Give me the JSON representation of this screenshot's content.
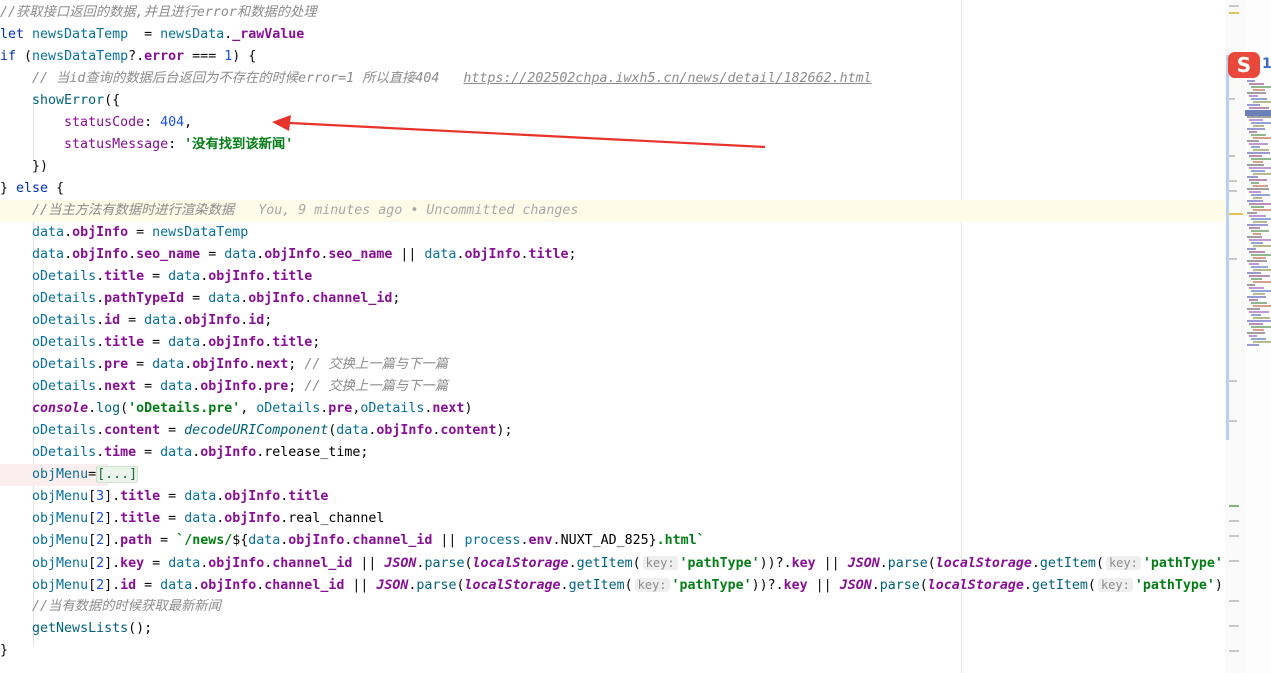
{
  "lines": [
    [
      {
        "t": "//获取接口返回的数据,并且进行error和数据的处理",
        "c": "c"
      }
    ],
    [
      {
        "t": "let ",
        "c": "kw"
      },
      {
        "t": "newsDataTemp  ",
        "c": "lv"
      },
      {
        "t": "= ",
        "c": "plain"
      },
      {
        "t": "newsData",
        "c": "lv"
      },
      {
        "t": ".",
        "c": "plain"
      },
      {
        "t": "_rawValue",
        "c": "prop"
      }
    ],
    [
      {
        "t": "if ",
        "c": "kw"
      },
      {
        "t": "(",
        "c": "plain"
      },
      {
        "t": "newsDataTemp",
        "c": "lv"
      },
      {
        "t": "?.",
        "c": "plain"
      },
      {
        "t": "error",
        "c": "prop"
      },
      {
        "t": " === ",
        "c": "plain"
      },
      {
        "t": "1",
        "c": "num"
      },
      {
        "t": ") {",
        "c": "plain"
      }
    ],
    [
      {
        "t": "    // 当id查询的数据后台返回为不存在的时候error=1 所以直接404   ",
        "c": "c"
      },
      {
        "t": "https://202502chpa.iwxh5.cn/news/detail/182662.html",
        "c": "url"
      }
    ],
    [
      {
        "t": "    ",
        "c": "plain"
      },
      {
        "t": "showError",
        "c": "fn"
      },
      {
        "t": "({",
        "c": "plain"
      }
    ],
    [
      {
        "t": "        ",
        "c": "plain"
      },
      {
        "t": "statusCode",
        "c": "propn"
      },
      {
        "t": ": ",
        "c": "plain"
      },
      {
        "t": "404",
        "c": "num"
      },
      {
        "t": ",",
        "c": "plain"
      }
    ],
    [
      {
        "t": "        ",
        "c": "plain"
      },
      {
        "t": "statusMessage",
        "c": "propn"
      },
      {
        "t": ": ",
        "c": "plain"
      },
      {
        "t": "'没有找到该新闻'",
        "c": "str"
      }
    ],
    [
      {
        "t": "    })",
        "c": "plain"
      }
    ],
    [
      {
        "t": "} ",
        "c": "plain"
      },
      {
        "t": "else ",
        "c": "kw"
      },
      {
        "t": "{",
        "c": "plain"
      }
    ],
    [
      {
        "t": "    //当主方法有数据时进行渲染数据   ",
        "c": "c"
      },
      {
        "t": "You, 9 minutes ago • Uncommitted changes",
        "c": "blame"
      }
    ],
    [
      {
        "t": "    ",
        "c": "plain"
      },
      {
        "t": "data",
        "c": "lv"
      },
      {
        "t": ".",
        "c": "plain"
      },
      {
        "t": "objInfo",
        "c": "prop"
      },
      {
        "t": " = ",
        "c": "plain"
      },
      {
        "t": "newsDataTemp",
        "c": "lv"
      }
    ],
    [
      {
        "t": "    ",
        "c": "plain"
      },
      {
        "t": "data",
        "c": "lv"
      },
      {
        "t": ".",
        "c": "plain"
      },
      {
        "t": "objInfo",
        "c": "prop"
      },
      {
        "t": ".",
        "c": "plain"
      },
      {
        "t": "seo_name",
        "c": "prop"
      },
      {
        "t": " = ",
        "c": "plain"
      },
      {
        "t": "data",
        "c": "lv"
      },
      {
        "t": ".",
        "c": "plain"
      },
      {
        "t": "objInfo",
        "c": "prop"
      },
      {
        "t": ".",
        "c": "plain"
      },
      {
        "t": "seo_name",
        "c": "prop"
      },
      {
        "t": " || ",
        "c": "plain"
      },
      {
        "t": "data",
        "c": "lv"
      },
      {
        "t": ".",
        "c": "plain"
      },
      {
        "t": "objInfo",
        "c": "prop"
      },
      {
        "t": ".",
        "c": "plain"
      },
      {
        "t": "title",
        "c": "prop"
      },
      {
        "t": ";",
        "c": "plain"
      }
    ],
    [
      {
        "t": "    ",
        "c": "plain"
      },
      {
        "t": "oDetails",
        "c": "lv"
      },
      {
        "t": ".",
        "c": "plain"
      },
      {
        "t": "title",
        "c": "prop"
      },
      {
        "t": " = ",
        "c": "plain"
      },
      {
        "t": "data",
        "c": "lv"
      },
      {
        "t": ".",
        "c": "plain"
      },
      {
        "t": "objInfo",
        "c": "prop"
      },
      {
        "t": ".",
        "c": "plain"
      },
      {
        "t": "title",
        "c": "prop"
      }
    ],
    [
      {
        "t": "    ",
        "c": "plain"
      },
      {
        "t": "oDetails",
        "c": "lv"
      },
      {
        "t": ".",
        "c": "plain"
      },
      {
        "t": "pathTypeId",
        "c": "prop"
      },
      {
        "t": " = ",
        "c": "plain"
      },
      {
        "t": "data",
        "c": "lv"
      },
      {
        "t": ".",
        "c": "plain"
      },
      {
        "t": "objInfo",
        "c": "prop"
      },
      {
        "t": ".",
        "c": "plain"
      },
      {
        "t": "channel_id",
        "c": "prop"
      },
      {
        "t": ";",
        "c": "plain"
      }
    ],
    [
      {
        "t": "    ",
        "c": "plain"
      },
      {
        "t": "oDetails",
        "c": "lv"
      },
      {
        "t": ".",
        "c": "plain"
      },
      {
        "t": "id",
        "c": "prop"
      },
      {
        "t": " = ",
        "c": "plain"
      },
      {
        "t": "data",
        "c": "lv"
      },
      {
        "t": ".",
        "c": "plain"
      },
      {
        "t": "objInfo",
        "c": "prop"
      },
      {
        "t": ".",
        "c": "plain"
      },
      {
        "t": "id",
        "c": "prop"
      },
      {
        "t": ";",
        "c": "plain"
      }
    ],
    [
      {
        "t": "    ",
        "c": "plain"
      },
      {
        "t": "oDetails",
        "c": "lv"
      },
      {
        "t": ".",
        "c": "plain"
      },
      {
        "t": "title",
        "c": "prop"
      },
      {
        "t": " = ",
        "c": "plain"
      },
      {
        "t": "data",
        "c": "lv"
      },
      {
        "t": ".",
        "c": "plain"
      },
      {
        "t": "objInfo",
        "c": "prop"
      },
      {
        "t": ".",
        "c": "plain"
      },
      {
        "t": "title",
        "c": "prop"
      },
      {
        "t": ";",
        "c": "plain"
      }
    ],
    [
      {
        "t": "    ",
        "c": "plain"
      },
      {
        "t": "oDetails",
        "c": "lv"
      },
      {
        "t": ".",
        "c": "plain"
      },
      {
        "t": "pre",
        "c": "prop"
      },
      {
        "t": " = ",
        "c": "plain"
      },
      {
        "t": "data",
        "c": "lv"
      },
      {
        "t": ".",
        "c": "plain"
      },
      {
        "t": "objInfo",
        "c": "prop"
      },
      {
        "t": ".",
        "c": "plain"
      },
      {
        "t": "next",
        "c": "prop"
      },
      {
        "t": "; ",
        "c": "plain"
      },
      {
        "t": "// 交换上一篇与下一篇",
        "c": "c"
      }
    ],
    [
      {
        "t": "    ",
        "c": "plain"
      },
      {
        "t": "oDetails",
        "c": "lv"
      },
      {
        "t": ".",
        "c": "plain"
      },
      {
        "t": "next",
        "c": "prop"
      },
      {
        "t": " = ",
        "c": "plain"
      },
      {
        "t": "data",
        "c": "lv"
      },
      {
        "t": ".",
        "c": "plain"
      },
      {
        "t": "objInfo",
        "c": "prop"
      },
      {
        "t": ".",
        "c": "plain"
      },
      {
        "t": "pre",
        "c": "prop"
      },
      {
        "t": "; ",
        "c": "plain"
      },
      {
        "t": "// 交换上一篇与下一篇",
        "c": "c"
      }
    ],
    [
      {
        "t": "    ",
        "c": "plain"
      },
      {
        "t": "console",
        "c": "gbl"
      },
      {
        "t": ".",
        "c": "plain"
      },
      {
        "t": "log",
        "c": "fn"
      },
      {
        "t": "(",
        "c": "plain"
      },
      {
        "t": "'oDetails.pre'",
        "c": "str"
      },
      {
        "t": ", ",
        "c": "plain"
      },
      {
        "t": "oDetails",
        "c": "lv"
      },
      {
        "t": ".",
        "c": "plain"
      },
      {
        "t": "pre",
        "c": "prop"
      },
      {
        "t": ",",
        "c": "plain"
      },
      {
        "t": "oDetails",
        "c": "lv"
      },
      {
        "t": ".",
        "c": "plain"
      },
      {
        "t": "next",
        "c": "prop"
      },
      {
        "t": ")",
        "c": "plain"
      }
    ],
    [
      {
        "t": "    ",
        "c": "plain"
      },
      {
        "t": "oDetails",
        "c": "lv"
      },
      {
        "t": ".",
        "c": "plain"
      },
      {
        "t": "content",
        "c": "prop"
      },
      {
        "t": " = ",
        "c": "plain"
      },
      {
        "t": "decodeURIComponent",
        "c": "fni"
      },
      {
        "t": "(",
        "c": "plain"
      },
      {
        "t": "data",
        "c": "lv"
      },
      {
        "t": ".",
        "c": "plain"
      },
      {
        "t": "objInfo",
        "c": "prop"
      },
      {
        "t": ".",
        "c": "plain"
      },
      {
        "t": "content",
        "c": "prop"
      },
      {
        "t": ");",
        "c": "plain"
      }
    ],
    [
      {
        "t": "    ",
        "c": "plain"
      },
      {
        "t": "oDetails",
        "c": "lv"
      },
      {
        "t": ".",
        "c": "plain"
      },
      {
        "t": "time",
        "c": "prop"
      },
      {
        "t": " = ",
        "c": "plain"
      },
      {
        "t": "data",
        "c": "lv"
      },
      {
        "t": ".",
        "c": "plain"
      },
      {
        "t": "objInfo",
        "c": "prop"
      },
      {
        "t": ".",
        "c": "plain"
      },
      {
        "t": "release_time",
        "c": "v"
      },
      {
        "t": ";",
        "c": "plain"
      }
    ],
    [
      {
        "t": "    ",
        "c": "plain"
      },
      {
        "t": "objMenu",
        "c": "lv"
      },
      {
        "t": "=",
        "c": "plain"
      },
      {
        "t": "[...]",
        "c": "fold"
      }
    ],
    [
      {
        "t": "    ",
        "c": "plain"
      },
      {
        "t": "objMenu",
        "c": "lv"
      },
      {
        "t": "[",
        "c": "plain"
      },
      {
        "t": "3",
        "c": "num"
      },
      {
        "t": "].",
        "c": "plain"
      },
      {
        "t": "title",
        "c": "prop"
      },
      {
        "t": " = ",
        "c": "plain"
      },
      {
        "t": "data",
        "c": "lv"
      },
      {
        "t": ".",
        "c": "plain"
      },
      {
        "t": "objInfo",
        "c": "prop"
      },
      {
        "t": ".",
        "c": "plain"
      },
      {
        "t": "title",
        "c": "prop"
      }
    ],
    [
      {
        "t": "    ",
        "c": "plain"
      },
      {
        "t": "objMenu",
        "c": "lv"
      },
      {
        "t": "[",
        "c": "plain"
      },
      {
        "t": "2",
        "c": "num"
      },
      {
        "t": "].",
        "c": "plain"
      },
      {
        "t": "title",
        "c": "prop"
      },
      {
        "t": " = ",
        "c": "plain"
      },
      {
        "t": "data",
        "c": "lv"
      },
      {
        "t": ".",
        "c": "plain"
      },
      {
        "t": "objInfo",
        "c": "prop"
      },
      {
        "t": ".",
        "c": "plain"
      },
      {
        "t": "real_channel",
        "c": "v"
      }
    ],
    [
      {
        "t": "    ",
        "c": "plain"
      },
      {
        "t": "objMenu",
        "c": "lv"
      },
      {
        "t": "[",
        "c": "plain"
      },
      {
        "t": "2",
        "c": "num"
      },
      {
        "t": "].",
        "c": "plain"
      },
      {
        "t": "path",
        "c": "prop"
      },
      {
        "t": " = ",
        "c": "plain"
      },
      {
        "t": "`/news/",
        "c": "str"
      },
      {
        "t": "${",
        "c": "plain"
      },
      {
        "t": "data",
        "c": "lv"
      },
      {
        "t": ".",
        "c": "plain"
      },
      {
        "t": "objInfo",
        "c": "prop"
      },
      {
        "t": ".",
        "c": "plain"
      },
      {
        "t": "channel_id",
        "c": "prop"
      },
      {
        "t": " || ",
        "c": "plain"
      },
      {
        "t": "process",
        "c": "lv"
      },
      {
        "t": ".",
        "c": "plain"
      },
      {
        "t": "env",
        "c": "prop"
      },
      {
        "t": ".",
        "c": "plain"
      },
      {
        "t": "NUXT_AD_825",
        "c": "v"
      },
      {
        "t": "}",
        "c": "plain"
      },
      {
        "t": ".html`",
        "c": "str"
      }
    ],
    [
      {
        "t": "    ",
        "c": "plain"
      },
      {
        "t": "objMenu",
        "c": "lv"
      },
      {
        "t": "[",
        "c": "plain"
      },
      {
        "t": "2",
        "c": "num"
      },
      {
        "t": "].",
        "c": "plain"
      },
      {
        "t": "key",
        "c": "prop"
      },
      {
        "t": " = ",
        "c": "plain"
      },
      {
        "t": "data",
        "c": "lv"
      },
      {
        "t": ".",
        "c": "plain"
      },
      {
        "t": "objInfo",
        "c": "prop"
      },
      {
        "t": ".",
        "c": "plain"
      },
      {
        "t": "channel_id",
        "c": "prop"
      },
      {
        "t": " || ",
        "c": "plain"
      },
      {
        "t": "JSON",
        "c": "gbl"
      },
      {
        "t": ".",
        "c": "plain"
      },
      {
        "t": "parse",
        "c": "fn"
      },
      {
        "t": "(",
        "c": "plain"
      },
      {
        "t": "localStorage",
        "c": "gbl"
      },
      {
        "t": ".",
        "c": "plain"
      },
      {
        "t": "getItem",
        "c": "fn"
      },
      {
        "t": "(",
        "c": "plain"
      },
      {
        "t": "key:",
        "c": "hint"
      },
      {
        "t": "'pathType'",
        "c": "str"
      },
      {
        "t": "))?.",
        "c": "plain"
      },
      {
        "t": "key",
        "c": "prop"
      },
      {
        "t": " || ",
        "c": "plain"
      },
      {
        "t": "JSON",
        "c": "gbl"
      },
      {
        "t": ".",
        "c": "plain"
      },
      {
        "t": "parse",
        "c": "fn"
      },
      {
        "t": "(",
        "c": "plain"
      },
      {
        "t": "localStorage",
        "c": "gbl"
      },
      {
        "t": ".",
        "c": "plain"
      },
      {
        "t": "getItem",
        "c": "fn"
      },
      {
        "t": "(",
        "c": "plain"
      },
      {
        "t": "key:",
        "c": "hint"
      },
      {
        "t": "'pathType'",
        "c": "str"
      },
      {
        "t": "))?",
        "c": "plain"
      }
    ],
    [
      {
        "t": "    ",
        "c": "plain"
      },
      {
        "t": "objMenu",
        "c": "lv"
      },
      {
        "t": "[",
        "c": "plain"
      },
      {
        "t": "2",
        "c": "num"
      },
      {
        "t": "].",
        "c": "plain"
      },
      {
        "t": "id",
        "c": "prop"
      },
      {
        "t": " = ",
        "c": "plain"
      },
      {
        "t": "data",
        "c": "lv"
      },
      {
        "t": ".",
        "c": "plain"
      },
      {
        "t": "objInfo",
        "c": "prop"
      },
      {
        "t": ".",
        "c": "plain"
      },
      {
        "t": "channel_id",
        "c": "prop"
      },
      {
        "t": " || ",
        "c": "plain"
      },
      {
        "t": "JSON",
        "c": "gbl"
      },
      {
        "t": ".",
        "c": "plain"
      },
      {
        "t": "parse",
        "c": "fn"
      },
      {
        "t": "(",
        "c": "plain"
      },
      {
        "t": "localStorage",
        "c": "gbl"
      },
      {
        "t": ".",
        "c": "plain"
      },
      {
        "t": "getItem",
        "c": "fn"
      },
      {
        "t": "(",
        "c": "plain"
      },
      {
        "t": "key:",
        "c": "hint"
      },
      {
        "t": "'pathType'",
        "c": "str"
      },
      {
        "t": "))?.",
        "c": "plain"
      },
      {
        "t": "key",
        "c": "prop"
      },
      {
        "t": " || ",
        "c": "plain"
      },
      {
        "t": "JSON",
        "c": "gbl"
      },
      {
        "t": ".",
        "c": "plain"
      },
      {
        "t": "parse",
        "c": "fn"
      },
      {
        "t": "(",
        "c": "plain"
      },
      {
        "t": "localStorage",
        "c": "gbl"
      },
      {
        "t": ".",
        "c": "plain"
      },
      {
        "t": "getItem",
        "c": "fn"
      },
      {
        "t": "(",
        "c": "plain"
      },
      {
        "t": "key:",
        "c": "hint"
      },
      {
        "t": "'pathType'",
        "c": "str"
      },
      {
        "t": "))?.",
        "c": "plain"
      }
    ],
    [
      {
        "t": "    //当有数据的时候获取最新新闻",
        "c": "c"
      }
    ],
    [
      {
        "t": "    ",
        "c": "plain"
      },
      {
        "t": "getNewsLists",
        "c": "fn"
      },
      {
        "t": "();",
        "c": "plain"
      }
    ],
    [
      {
        "t": "}",
        "c": "plain"
      }
    ]
  ],
  "current_line_index": 9,
  "folded_line_index": 21,
  "sidebar": {
    "logo_glyph": "S",
    "logo_side_glyph": "1"
  },
  "colors": {
    "annotation_arrow": "#e8332a",
    "current_line_bg": "#fefbe8"
  }
}
